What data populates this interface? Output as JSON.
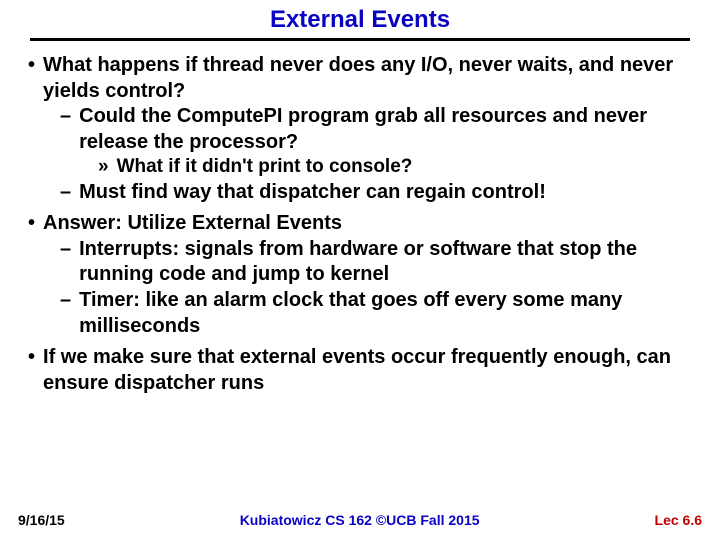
{
  "title": "External Events",
  "bullets": {
    "q": "What happens if thread never does any I/O, never waits, and never yields control?",
    "q_sub1": "Could the ComputePI program grab all resources and never release the processor?",
    "q_sub1a": "What if it didn't print to console?",
    "q_sub2": "Must find way that dispatcher can regain control!",
    "ans": "Answer: Utilize External Events",
    "ans_sub1": "Interrupts: signals from hardware or software that stop the running code and jump to kernel",
    "ans_sub2": "Timer: like an alarm clock that goes off every some many milliseconds",
    "concl": "If we make sure that external events occur frequently enough, can ensure dispatcher runs"
  },
  "footer": {
    "date": "9/16/15",
    "center": "Kubiatowicz CS 162 ©UCB Fall 2015",
    "right": "Lec 6.6"
  },
  "glyph": {
    "dot": "•",
    "dash": "–",
    "raquo": "»"
  }
}
